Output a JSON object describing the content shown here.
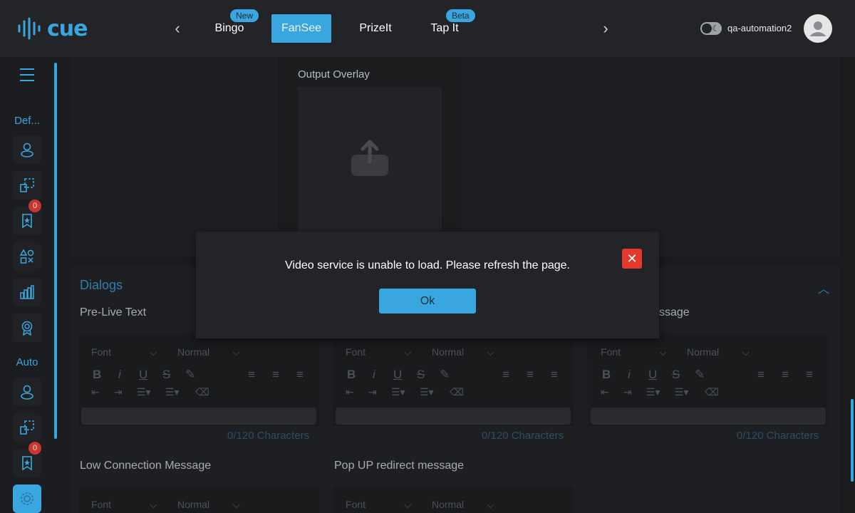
{
  "header": {
    "logo_text": "cue",
    "tabs": [
      {
        "label": "Bingo",
        "pill": "New"
      },
      {
        "label": "FanSee",
        "active": true
      },
      {
        "label": "PrizeIt"
      },
      {
        "label": "Tap It",
        "pill": "Beta"
      }
    ],
    "username": "qa-automation2"
  },
  "sidebar": {
    "sections": [
      {
        "label": "Def...",
        "items": [
          "user-icon",
          "layers-icon",
          "bookmark-star-icon",
          "shapes-icon",
          "bar-chart-icon",
          "award-icon"
        ]
      },
      {
        "label": "Auto",
        "items": [
          "user-icon",
          "layers-icon",
          "bookmark-star-icon",
          "settings-icon"
        ]
      }
    ],
    "badges": [
      "0",
      "0"
    ]
  },
  "main": {
    "overlay_label": "Output Overlay",
    "section_title": "Dialogs",
    "fields": [
      {
        "label": "Pre-Live Text",
        "counter": "0/120 Characters"
      },
      {
        "label": "",
        "counter": "0/120 Characters"
      },
      {
        "label": "ssage",
        "counter": "0/120 Characters"
      },
      {
        "label": "Low Connection Message"
      },
      {
        "label": "Pop UP redirect message"
      }
    ],
    "toolbar": {
      "font": "Font",
      "size": "Normal"
    }
  },
  "modal": {
    "message": "Video service is unable to load. Please refresh the page.",
    "ok_label": "Ok"
  },
  "colors": {
    "accent": "#3aa6df",
    "danger": "#e5382d",
    "background": "#1b1c1e"
  }
}
